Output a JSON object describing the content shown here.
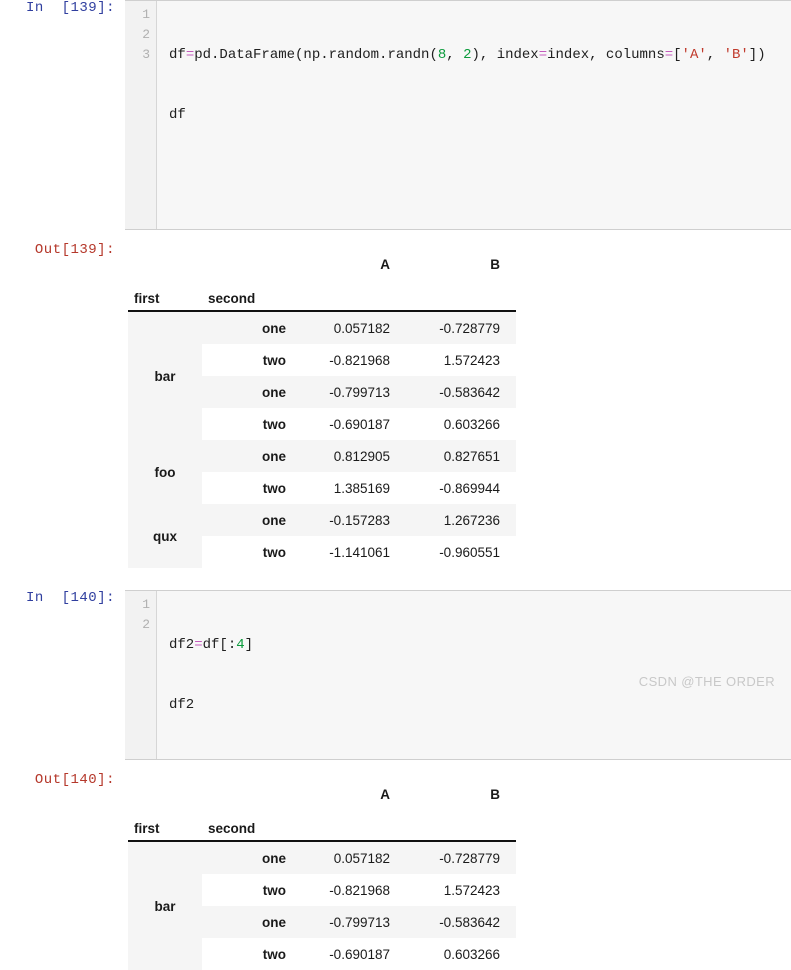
{
  "cells": [
    {
      "input_prompt": "In  [139]:",
      "line_numbers": [
        "1",
        "2",
        "3"
      ],
      "code_line_1": {
        "a": "df",
        "eq1": "=",
        "b": "pd.DataFrame(np.random.randn(",
        "n8": "8",
        "comma1": ", ",
        "n2": "2",
        "c": "), index",
        "eq2": "=",
        "d": "index, columns",
        "eq3": "=",
        "bracket_open": "[",
        "strA": "'A'",
        "comma2": ", ",
        "strB": "'B'",
        "bracket_close": "])"
      },
      "code_line_2": "df",
      "code_line_3": "",
      "output_prompt": "Out[139]:",
      "table": {
        "columns": [
          "A",
          "B"
        ],
        "index_names": [
          "first",
          "second"
        ],
        "rows": [
          {
            "first": "bar",
            "second": "one",
            "A": "0.057182",
            "B": "-0.728779"
          },
          {
            "first": "",
            "second": "two",
            "A": "-0.821968",
            "B": "1.572423"
          },
          {
            "first": "",
            "second": "one",
            "A": "-0.799713",
            "B": "-0.583642"
          },
          {
            "first": "",
            "second": "two",
            "A": "-0.690187",
            "B": "0.603266"
          },
          {
            "first": "foo",
            "second": "one",
            "A": "0.812905",
            "B": "0.827651"
          },
          {
            "first": "",
            "second": "two",
            "A": "1.385169",
            "B": "-0.869944"
          },
          {
            "first": "qux",
            "second": "one",
            "A": "-0.157283",
            "B": "1.267236"
          },
          {
            "first": "",
            "second": "two",
            "A": "-1.141061",
            "B": "-0.960551"
          }
        ]
      }
    },
    {
      "input_prompt": "In  [140]:",
      "line_numbers": [
        "1",
        "2"
      ],
      "code_line_1": {
        "a": "df2",
        "eq1": "=",
        "b": "df[:",
        "n4": "4",
        "bracket_close": "]"
      },
      "code_line_2": "df2",
      "output_prompt": "Out[140]:",
      "table": {
        "columns": [
          "A",
          "B"
        ],
        "index_names": [
          "first",
          "second"
        ],
        "rows": [
          {
            "first": "bar",
            "second": "one",
            "A": "0.057182",
            "B": "-0.728779"
          },
          {
            "first": "",
            "second": "two",
            "A": "-0.821968",
            "B": "1.572423"
          },
          {
            "first": "",
            "second": "one",
            "A": "-0.799713",
            "B": "-0.583642"
          },
          {
            "first": "",
            "second": "two",
            "A": "-0.690187",
            "B": "0.603266"
          }
        ]
      }
    }
  ],
  "watermark": "CSDN @THE ORDER",
  "colors": {
    "prompt_in": "#303f9f",
    "prompt_out": "#b5382b",
    "operator": "#c45bbd",
    "number": "#0b9b3c",
    "string": "#c0392b",
    "row_stripe": "#f5f5f5",
    "code_background": "#f7f7f7"
  }
}
